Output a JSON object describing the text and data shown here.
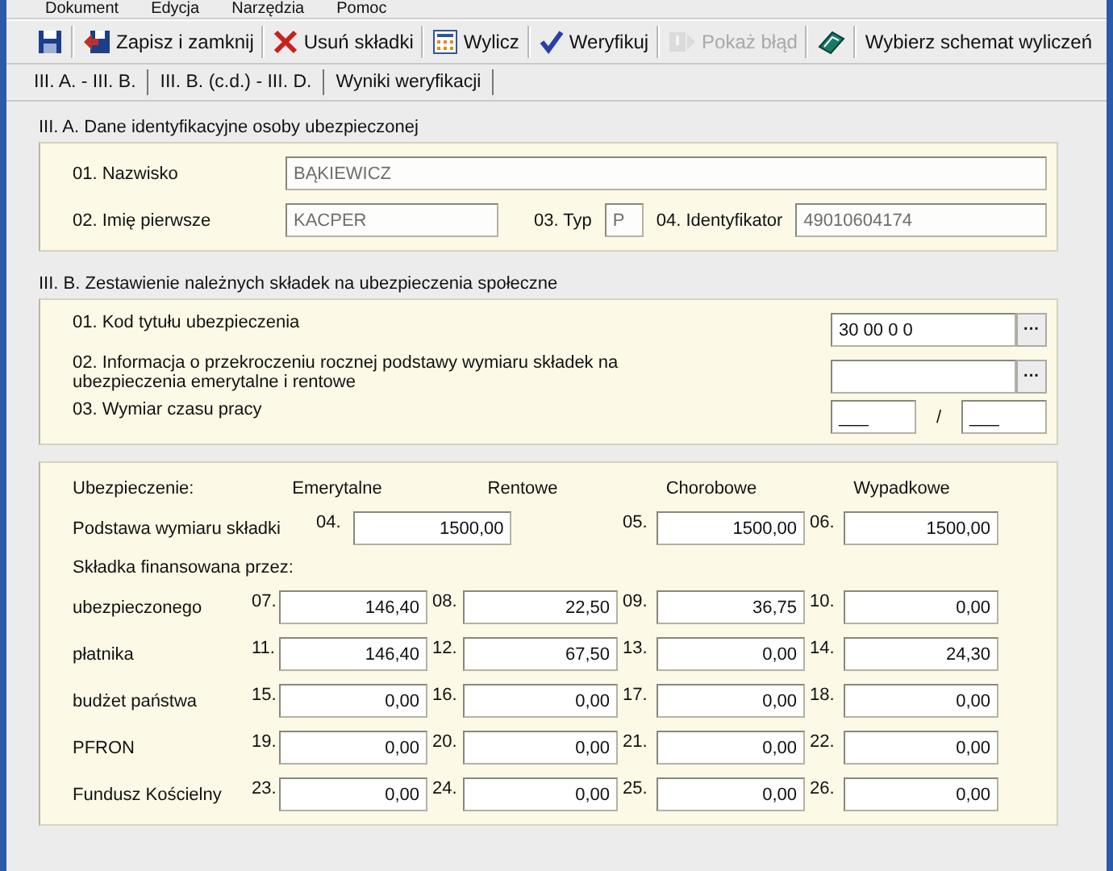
{
  "menu": [
    "Dokument",
    "Edycja",
    "Narzędzia",
    "Pomoc"
  ],
  "toolbar": [
    {
      "kind": "icon",
      "disabled": false
    },
    {
      "kind": "icon_text",
      "label": "Zapisz i zamknij",
      "disabled": false
    },
    {
      "kind": "icon_text",
      "label": "Usuń składki",
      "disabled": false
    },
    {
      "kind": "icon_text",
      "label": "Wylicz",
      "disabled": false
    },
    {
      "kind": "icon_text",
      "label": "Weryfikuj",
      "disabled": false
    },
    {
      "kind": "icon_text",
      "label": "Pokaż błąd",
      "disabled": true
    },
    {
      "kind": "icon",
      "disabled": false
    },
    {
      "kind": "text",
      "label": "Wybierz schemat wyliczeń",
      "disabled": false
    }
  ],
  "tabs": [
    "III. A. - III. B.",
    "III. B. (c.d.) - III. D.",
    "Wyniki weryfikacji"
  ],
  "section_a": {
    "title": "III. A. Dane identyfikacyjne osoby ubezpieczonej",
    "nazwisko": {
      "label": "01. Nazwisko",
      "value": "BĄKIEWICZ"
    },
    "imie": {
      "label": "02. Imię pierwsze",
      "value": "KACPER"
    },
    "typ": {
      "label": "03. Typ",
      "value": "P"
    },
    "identyfikator": {
      "label": "04. Identyfikator",
      "value": "49010604174"
    }
  },
  "section_b": {
    "title": "III. B. Zestawienie należnych składek na ubezpieczenia społeczne",
    "kod": {
      "label": "01. Kod tytułu ubezpieczenia",
      "value": "30 00 0 0",
      "button": "···"
    },
    "informacja": {
      "label": "02. Informacja o przekroczeniu rocznej podstawy wymiaru składek na ubezpieczenia emerytalne i rentowe",
      "button": "···"
    },
    "wymiar": {
      "label": "03. Wymiar czasu pracy",
      "numerator": "___",
      "separator": "/",
      "denominator": "___"
    }
  },
  "contributions": {
    "header_label": "Ubezpieczenie:",
    "columns": [
      "Emerytalne",
      "Rentowe",
      "Chorobowe",
      "Wypadkowe"
    ],
    "basis": {
      "label": "Podstawa wymiaru składki",
      "cells": [
        {
          "number": "04.",
          "value": "1500,00"
        },
        {
          "number": "05.",
          "value": "1500,00"
        },
        {
          "number": "06.",
          "value": "1500,00"
        }
      ]
    },
    "financed_label": "Składka finansowana przez:",
    "rows": [
      {
        "label": "ubezpieczonego",
        "cells": [
          {
            "number": "07.",
            "value": "146,40"
          },
          {
            "number": "08.",
            "value": "22,50"
          },
          {
            "number": "09.",
            "value": "36,75"
          },
          {
            "number": "10.",
            "value": "0,00"
          }
        ]
      },
      {
        "label": "płatnika",
        "cells": [
          {
            "number": "11.",
            "value": "146,40"
          },
          {
            "number": "12.",
            "value": "67,50"
          },
          {
            "number": "13.",
            "value": "0,00"
          },
          {
            "number": "14.",
            "value": "24,30"
          }
        ]
      },
      {
        "label": "budżet państwa",
        "cells": [
          {
            "number": "15.",
            "value": "0,00"
          },
          {
            "number": "16.",
            "value": "0,00"
          },
          {
            "number": "17.",
            "value": "0,00"
          },
          {
            "number": "18.",
            "value": "0,00"
          }
        ]
      },
      {
        "label": "PFRON",
        "cells": [
          {
            "number": "19.",
            "value": "0,00"
          },
          {
            "number": "20.",
            "value": "0,00"
          },
          {
            "number": "21.",
            "value": "0,00"
          },
          {
            "number": "22.",
            "value": "0,00"
          }
        ]
      },
      {
        "label": "Fundusz Kościelny",
        "cells": [
          {
            "number": "23.",
            "value": "0,00"
          },
          {
            "number": "24.",
            "value": "0,00"
          },
          {
            "number": "25.",
            "value": "0,00"
          },
          {
            "number": "26.",
            "value": "0,00"
          }
        ]
      }
    ]
  }
}
